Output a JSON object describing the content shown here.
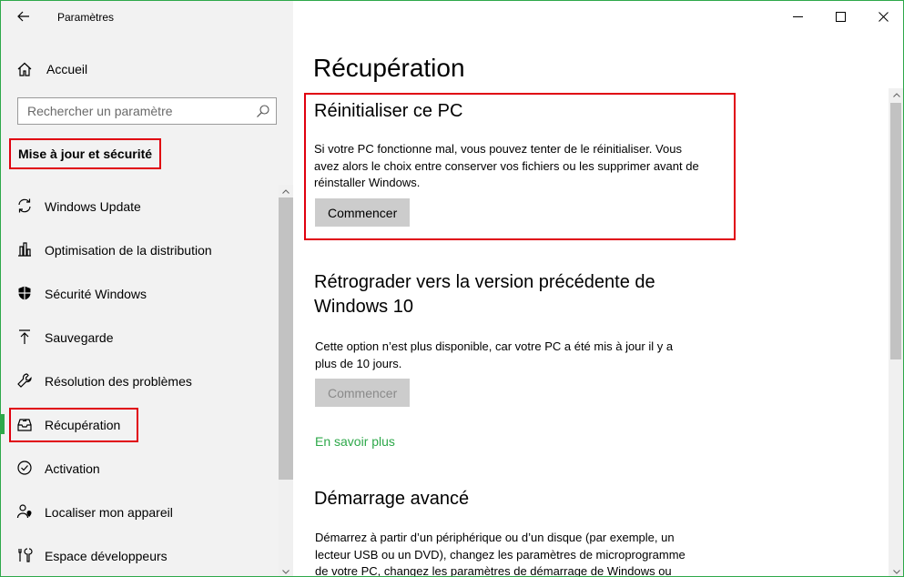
{
  "app": {
    "title": "Paramètres"
  },
  "sidebar": {
    "home_label": "Accueil",
    "search_placeholder": "Rechercher un paramètre",
    "section_title": "Mise à jour et sécurité",
    "items": [
      {
        "label": "Windows Update",
        "icon": "sync-icon"
      },
      {
        "label": "Optimisation de la distribution",
        "icon": "delivery-optimization-icon"
      },
      {
        "label": "Sécurité Windows",
        "icon": "shield-icon"
      },
      {
        "label": "Sauvegarde",
        "icon": "backup-arrow-icon"
      },
      {
        "label": "Résolution des problèmes",
        "icon": "wrench-icon"
      },
      {
        "label": "Récupération",
        "icon": "recovery-icon",
        "active": true
      },
      {
        "label": "Activation",
        "icon": "check-circle-icon"
      },
      {
        "label": "Localiser mon appareil",
        "icon": "person-pin-icon"
      },
      {
        "label": "Espace développeurs",
        "icon": "developer-tools-icon"
      }
    ]
  },
  "main": {
    "page_title": "Récupération",
    "reset": {
      "title": "Réinitialiser ce PC",
      "description_lines": [
        "Si votre PC fonctionne mal, vous pouvez tenter de le réinitialiser. Vous",
        "avez alors le choix entre conserver vos fichiers ou les supprimer avant de",
        "réinstaller Windows."
      ],
      "button": "Commencer"
    },
    "rollback": {
      "title_lines": [
        "Rétrograder vers la version précédente de",
        "Windows 10"
      ],
      "description_lines": [
        "Cette option n’est plus disponible, car votre PC a été mis à jour il y a",
        "plus de 10 jours."
      ],
      "button": "Commencer",
      "link": "En savoir plus"
    },
    "advanced": {
      "title": "Démarrage avancé",
      "description_lines": [
        "Démarrez à partir d’un périphérique ou d’un disque (par exemple, un",
        "lecteur USB ou un DVD), changez les paramètres de microprogramme",
        "de votre PC, changez les paramètres de démarrage de Windows ou"
      ]
    }
  },
  "colors": {
    "accent": "#2ea84a",
    "highlight": "#e0000f",
    "sidebar_bg": "#f2f2f2",
    "button_bg": "#cccccc"
  }
}
